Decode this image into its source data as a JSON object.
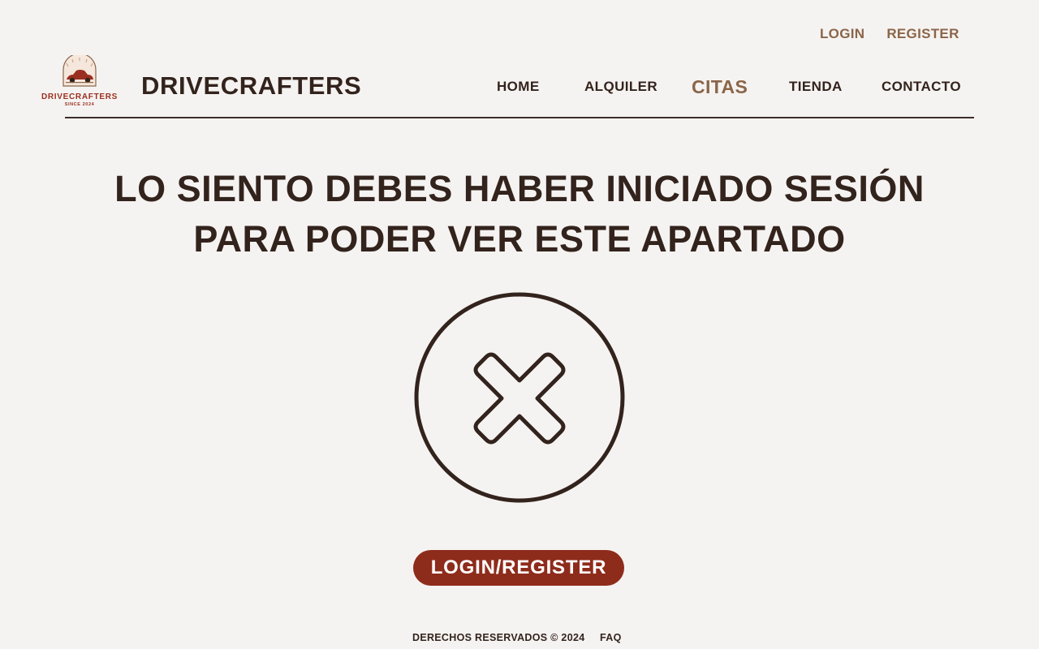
{
  "header": {
    "top_links": {
      "login": "LOGIN",
      "register": "REGISTER"
    },
    "logo": {
      "name": "DRIVECRAFTERS",
      "since": "SINCE 2024",
      "icon": "classic-car-icon"
    },
    "brand": "DRIVECRAFTERS",
    "nav": {
      "items": [
        {
          "label": "HOME"
        },
        {
          "label": "ALQUILER"
        },
        {
          "label": "CITAS"
        },
        {
          "label": "TIENDA"
        },
        {
          "label": "CONTACTO"
        }
      ],
      "active": "CITAS"
    }
  },
  "main": {
    "message_line1": "LO SIENTO DEBES HABER INICIADO SESIÓN",
    "message_line2": "PARA PODER VER ESTE APARTADO",
    "icon": "x-circle-icon",
    "button_label": "LOGIN/REGISTER"
  },
  "footer": {
    "copyright": "DERECHOS RESERVADOS © 2024",
    "faq": "FAQ"
  },
  "colors": {
    "background": "#f5f3f1",
    "text": "#33231d",
    "accent": "#8a6549",
    "button": "#8e2c1c",
    "logo_red": "#9a2f20"
  }
}
